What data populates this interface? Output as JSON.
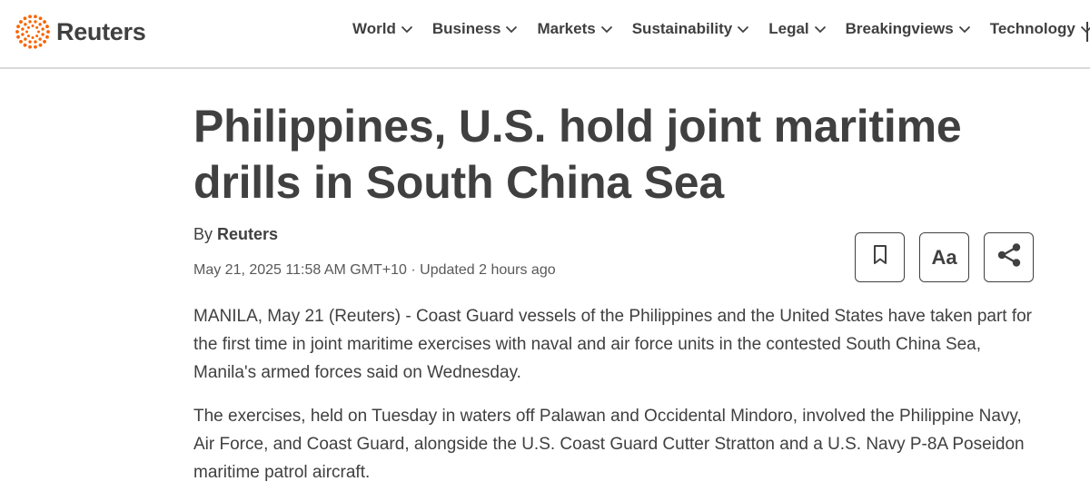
{
  "header": {
    "logo_text": "Reuters",
    "brand_color": "#fa6400",
    "nav": [
      {
        "label": "World",
        "icon": "chevron-down-icon"
      },
      {
        "label": "Business",
        "icon": "chevron-down-icon"
      },
      {
        "label": "Markets",
        "icon": "chevron-down-icon"
      },
      {
        "label": "Sustainability",
        "icon": "chevron-down-icon"
      },
      {
        "label": "Legal",
        "icon": "chevron-down-icon"
      },
      {
        "label": "Breakingviews",
        "icon": "chevron-down-icon"
      },
      {
        "label": "Technology",
        "icon": "chevron-down-icon"
      }
    ]
  },
  "article": {
    "headline": "Philippines, U.S. hold joint maritime drills in South China Sea",
    "byline_prefix": "By ",
    "author": "Reuters",
    "dateline": "May 21, 2025 11:58 AM GMT+10 · Updated 2 hours ago",
    "tools": {
      "bookmark_icon": "bookmark-icon",
      "text_size_label": "Aa",
      "share_icon": "share-icon"
    },
    "paragraphs": [
      "MANILA, May 21 (Reuters) - Coast Guard vessels of the Philippines and the United States have taken part for the first time in joint maritime exercises with naval and air force units in the contested South China Sea, Manila's armed forces said on Wednesday.",
      "The exercises, held on Tuesday in waters off Palawan and Occidental Mindoro, involved the Philippine Navy, Air Force, and Coast Guard, alongside the U.S. Coast Guard Cutter Stratton and a U.S. Navy P-8A Poseidon maritime patrol aircraft."
    ]
  }
}
